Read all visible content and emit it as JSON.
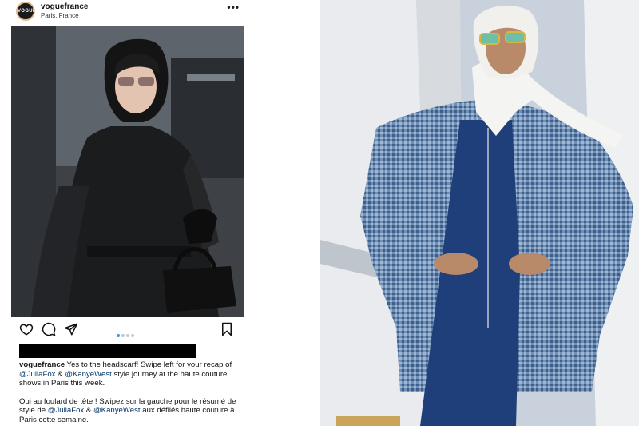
{
  "post": {
    "avatar_text": "VOGUE",
    "username": "voguefrance",
    "location": "Paris, France",
    "more_icon": "more-horizontal-icon",
    "actions": {
      "like_icon": "heart-icon",
      "comment_icon": "comment-icon",
      "share_icon": "paper-plane-icon",
      "save_icon": "bookmark-icon",
      "carousel_pages": 4,
      "carousel_active": 1
    },
    "caption": {
      "username": "voguefrance",
      "line1_a": " Yes to the headscarf! Swipe left for your recap of ",
      "mention_1": "@JuliaFox",
      "amp_1": " & ",
      "mention_2": "@KanyeWest",
      "line1_b": " style journey at the haute couture shows in Paris this week.",
      "line2_a": "Oui au foulard de tête ! Swipez sur la gauche pour le résumé de style de ",
      "mention_3": "@JuliaFox",
      "amp_2": " & ",
      "mention_4": "@KanyeWest",
      "line2_b": " aux défilés haute couture à Paris cette semaine."
    },
    "colors": {
      "link": "#00376b",
      "carousel_active": "#3897f0"
    }
  }
}
